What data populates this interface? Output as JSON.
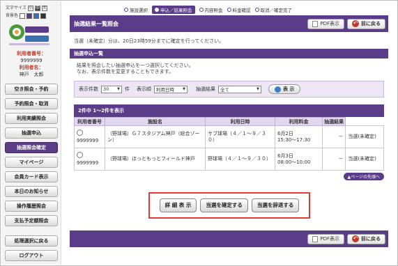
{
  "font_size": {
    "label": "文字サイズ",
    "small": "小",
    "medium": "中",
    "large": "大",
    "color_label": "背景色"
  },
  "colors": {
    "accent": "#5b3c88",
    "alert": "#e53935"
  },
  "user": {
    "number_label": "利用者番号：",
    "number": "9999999",
    "name_label": "利用者名：",
    "name": "神戸　太郎"
  },
  "menu": [
    {
      "label": "空き照会・予約"
    },
    {
      "label": "予約照会・取消"
    },
    {
      "label": "利用実績照会"
    },
    {
      "label": "抽選申込"
    },
    {
      "label": "抽選照会確定",
      "active": true
    },
    {
      "label": "マイページ"
    },
    {
      "label": "会員カード表示"
    },
    {
      "label": "本日のお知らせ"
    },
    {
      "label": "操作履歴照会"
    },
    {
      "label": "支払予定額照会"
    },
    {
      "label": "処理選択に戻る"
    },
    {
      "label": "ログアウト"
    }
  ],
  "steps": [
    "施設選択",
    "申込／結果照会",
    "内容照会",
    "料金確認",
    "取消／確定完了"
  ],
  "header": {
    "title": "抽選結果一覧照会",
    "pdf_label": "PDF表示",
    "back_label": "前に戻る"
  },
  "note": "当選（未確定）分は、20日23時59分までに確定を行ってください。",
  "section_title": "抽選申込一覧",
  "desc_line1": "結果を照会したい抽選申込を一つ選択してください。",
  "desc_line2": "なお、表示件数を変更することもできます。",
  "filter": {
    "count_label": "表示件数",
    "count_value": "30",
    "count_unit": "件",
    "order_label": "表示順",
    "order_value": "利用日時",
    "result_label": "抽選結果",
    "result_value": "全て",
    "show_label": "表 示"
  },
  "results": {
    "summary": "2件中 1～2件を表示",
    "columns": [
      "利用者番号",
      "施設名",
      "利用日時",
      "利用料金",
      "抽選結果"
    ],
    "rows": [
      {
        "user_no": "9999999",
        "facility": "（野球場）Ｇ７スタジアム神戸（総合ゾーン）",
        "usage": "サブ球場（４／１～９／３０）",
        "date": "6月2日",
        "time": "15:30～17:30",
        "fee": "－",
        "result": "当選(未確定)"
      },
      {
        "user_no": "9999999",
        "facility": "（野球場）ほっともっとフィールド神戸",
        "usage": "野球場（４／１～９／３０）",
        "date": "6月3日",
        "time": "08:00～10:00",
        "fee": "－",
        "result": "当選(未確定)"
      }
    ],
    "page_top": "▲ページの先頭へ"
  },
  "actions": {
    "detail": "詳 細 表 示",
    "confirm": "当選を確定する",
    "decline": "当選を辞退する"
  }
}
